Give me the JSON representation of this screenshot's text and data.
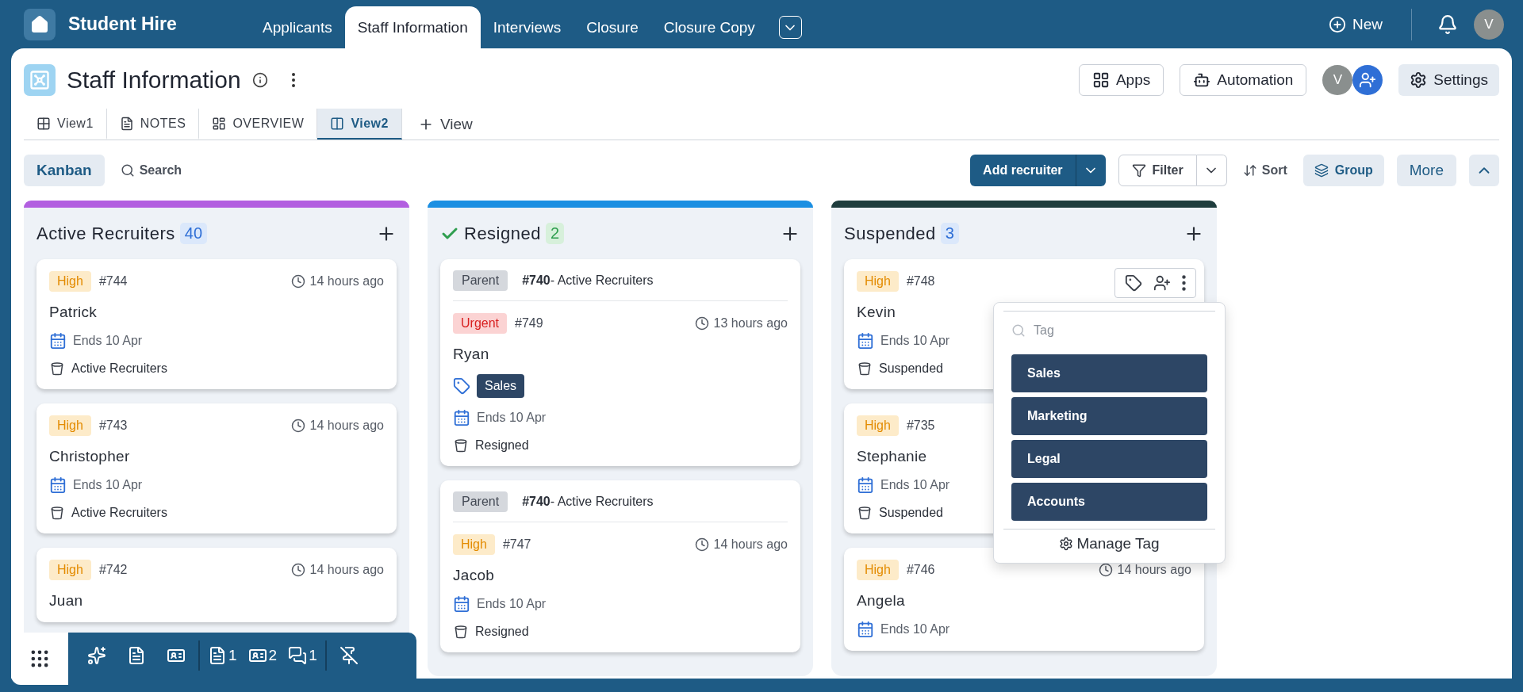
{
  "app": {
    "name": "Student Hire"
  },
  "nav_tabs": [
    {
      "label": "Applicants",
      "selected": false
    },
    {
      "label": "Staff Information",
      "selected": true
    },
    {
      "label": "Interviews",
      "selected": false
    },
    {
      "label": "Closure",
      "selected": false
    },
    {
      "label": "Closure Copy",
      "selected": false
    }
  ],
  "new_button": "New",
  "user": {
    "initial": "V"
  },
  "page": {
    "title": "Staff Information",
    "apps": "Apps",
    "automation": "Automation",
    "member_initial": "V",
    "settings": "Settings"
  },
  "views": [
    {
      "label": "View1",
      "kind": "table",
      "selected": false
    },
    {
      "label": "NOTES",
      "kind": "notes",
      "selected": false
    },
    {
      "label": "OVERVIEW",
      "kind": "overview",
      "selected": false
    },
    {
      "label": "View2",
      "kind": "kanban",
      "selected": true
    }
  ],
  "add_view": "View",
  "toolbar": {
    "layout": "Kanban",
    "search": "Search",
    "add": "Add recruiter",
    "filter": "Filter",
    "sort": "Sort",
    "group": "Group",
    "more": "More"
  },
  "columns": [
    {
      "title": "Active Recruiters",
      "count": "40",
      "color": "#b25fe0",
      "done": false,
      "cards": [
        {
          "priority": "High",
          "kind": "high",
          "id": "#744",
          "time": "14 hours ago",
          "name": "Patrick",
          "due": "Ends 10 Apr",
          "stage": "Active Recruiters",
          "actions": false
        },
        {
          "priority": "High",
          "kind": "high",
          "id": "#743",
          "time": "14 hours ago",
          "name": "Christopher",
          "due": "Ends 10 Apr",
          "stage": "Active Recruiters",
          "actions": false
        },
        {
          "priority": "High",
          "kind": "high",
          "id": "#742",
          "time": "14 hours ago",
          "name": "Juan",
          "actions": false
        }
      ]
    },
    {
      "title": "Resigned",
      "count": "2",
      "color": "#1b8fe2",
      "done": true,
      "cards": [
        {
          "parent": {
            "label": "Parent",
            "ref": "**#740**- Active Recruiters"
          },
          "priority": "Urgent",
          "kind": "urgent",
          "id": "#749",
          "time": "13 hours ago",
          "name": "Ryan",
          "tags": [
            "Sales"
          ],
          "due": "Ends 10 Apr",
          "stage": "Resigned",
          "actions": false
        },
        {
          "parent": {
            "label": "Parent",
            "ref": "**#740**- Active Recruiters"
          },
          "priority": "High",
          "kind": "high",
          "id": "#747",
          "time": "14 hours ago",
          "name": "Jacob",
          "due": "Ends 10 Apr",
          "stage": "Resigned",
          "actions": false
        }
      ]
    },
    {
      "title": "Suspended",
      "count": "3",
      "color": "#1f3d3d",
      "done": false,
      "cards": [
        {
          "priority": "High",
          "kind": "high",
          "id": "#748",
          "name": "Kevin",
          "due": "Ends 10 Apr",
          "stage": "Suspended",
          "actions": true
        },
        {
          "priority": "High",
          "kind": "high",
          "id": "#735",
          "name": "Stephanie",
          "due": "Ends 10 Apr",
          "stage": "Suspended"
        },
        {
          "priority": "High",
          "kind": "high",
          "id": "#746",
          "time": "14 hours ago",
          "name": "Angela",
          "due": "Ends 10 Apr",
          "actions": false
        }
      ]
    }
  ],
  "tag_menu": {
    "placeholder": "Tag",
    "tags": [
      "Sales",
      "Marketing",
      "Legal",
      "Accounts"
    ],
    "manage": "Manage Tag"
  },
  "dock": {
    "notes_count": "1",
    "cards_count": "2",
    "comments_count": "1"
  }
}
